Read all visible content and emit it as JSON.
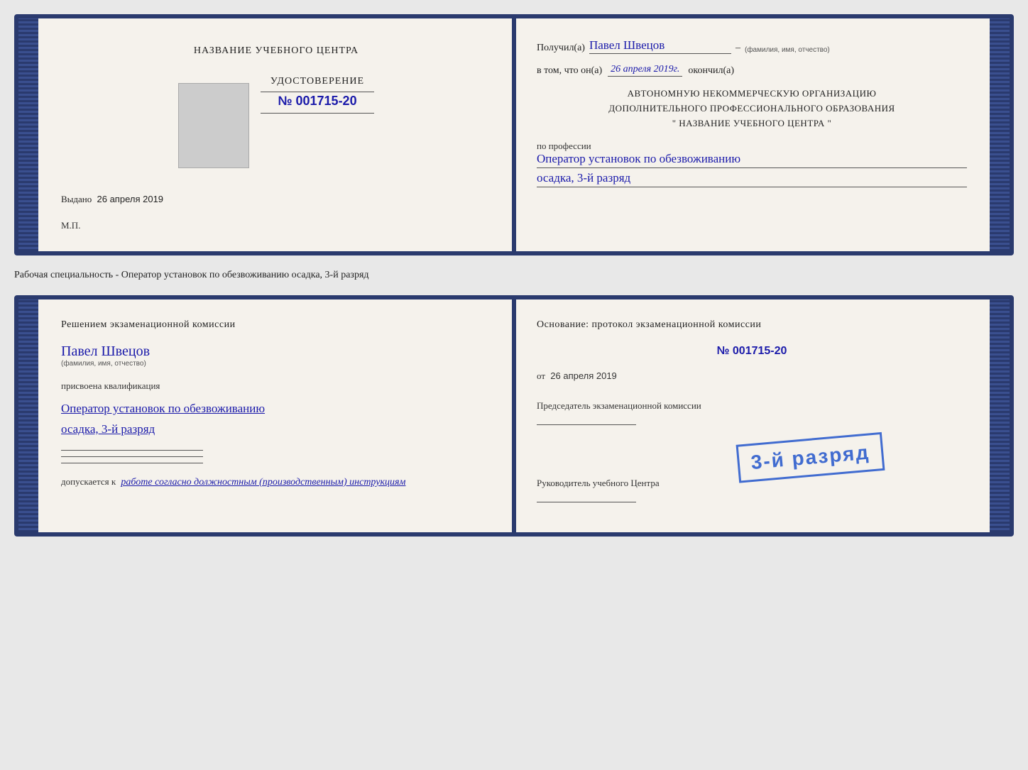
{
  "top_document": {
    "left": {
      "center_title": "НАЗВАНИЕ УЧЕБНОГО ЦЕНТРА",
      "cert_section": {
        "title": "УДОСТОВЕРЕНИЕ",
        "number_prefix": "№",
        "number": "001715-20"
      },
      "issued_label": "Выдано",
      "issued_date": "26 апреля 2019",
      "mp_label": "М.П."
    },
    "right": {
      "received_label": "Получил(а)",
      "recipient_name": "Павел Швецов",
      "name_subtitle": "(фамилия, имя, отчество)",
      "dash": "–",
      "in_that_label": "в том, что он(а)",
      "date_value": "26 апреля 2019г.",
      "finished_label": "окончил(а)",
      "org_line1": "АВТОНОМНУЮ НЕКОММЕРЧЕСКУЮ ОРГАНИЗАЦИЮ",
      "org_line2": "ДОПОЛНИТЕЛЬНОГО ПРОФЕССИОНАЛЬНОГО ОБРАЗОВАНИЯ",
      "org_line3": "\"  НАЗВАНИЕ УЧЕБНОГО ЦЕНТРА  \"",
      "profession_label": "по профессии",
      "profession_value": "Оператор установок по обезвоживанию",
      "profession_line2": "осадка, 3-й разряд"
    }
  },
  "separator": {
    "text": "Рабочая специальность - Оператор установок по обезвоживанию осадка, 3-й разряд"
  },
  "bottom_document": {
    "left": {
      "commission_title": "Решением экзаменационной комиссии",
      "person_name": "Павел Швецов",
      "name_subtitle": "(фамилия, имя, отчество)",
      "qualification_label": "присвоена квалификация",
      "qualification_line1": "Оператор установок по обезвоживанию",
      "qualification_line2": "осадка, 3-й разряд",
      "admission_label": "допускается к",
      "admission_value": "работе согласно должностным (производственным) инструкциям"
    },
    "right": {
      "basis_title": "Основание: протокол экзаменационной комиссии",
      "number_prefix": "№",
      "protocol_number": "001715-20",
      "from_label": "от",
      "from_date": "26 апреля 2019",
      "chairman_label": "Председатель экзаменационной комиссии",
      "stamp_text": "3-й разряд",
      "head_label": "Руководитель учебного Центра"
    }
  }
}
